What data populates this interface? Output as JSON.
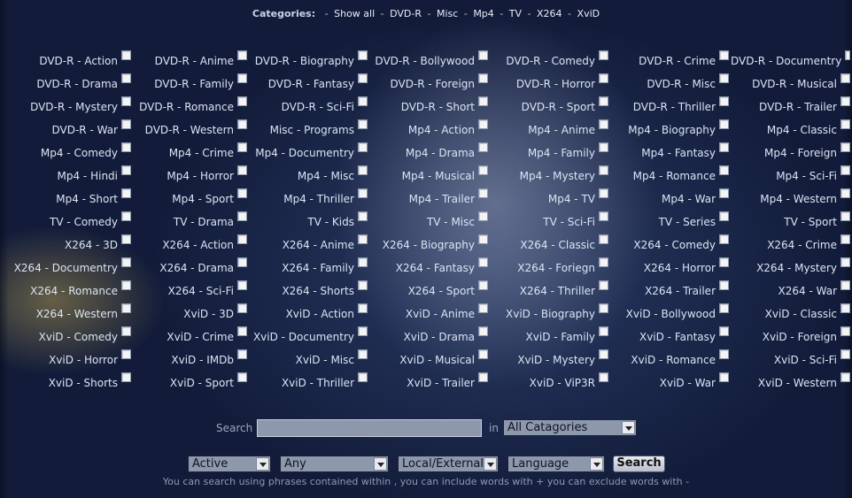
{
  "categories_bar": {
    "label": "Categories:",
    "links": [
      "Show all",
      "DVD-R",
      "Misc",
      "Mp4",
      "TV",
      "X264",
      "XviD"
    ]
  },
  "category_grid": [
    [
      "DVD-R - Action",
      "DVD-R - Anime",
      "DVD-R - Biography",
      "DVD-R - Bollywood",
      "DVD-R - Comedy",
      "DVD-R - Crime",
      "DVD-R - Documentry"
    ],
    [
      "DVD-R - Drama",
      "DVD-R - Family",
      "DVD-R - Fantasy",
      "DVD-R - Foreign",
      "DVD-R - Horror",
      "DVD-R - Misc",
      "DVD-R - Musical"
    ],
    [
      "DVD-R - Mystery",
      "DVD-R - Romance",
      "DVD-R - Sci-Fi",
      "DVD-R - Short",
      "DVD-R - Sport",
      "DVD-R - Thriller",
      "DVD-R - Trailer"
    ],
    [
      "DVD-R - War",
      "DVD-R - Western",
      "Misc - Programs",
      "Mp4 - Action",
      "Mp4 - Anime",
      "Mp4 - Biography",
      "Mp4 - Classic"
    ],
    [
      "Mp4 - Comedy",
      "Mp4 - Crime",
      "Mp4 - Documentry",
      "Mp4 - Drama",
      "Mp4 - Family",
      "Mp4 - Fantasy",
      "Mp4 - Foreign"
    ],
    [
      "Mp4 - Hindi",
      "Mp4 - Horror",
      "Mp4 - Misc",
      "Mp4 - Musical",
      "Mp4 - Mystery",
      "Mp4 - Romance",
      "Mp4 - Sci-Fi"
    ],
    [
      "Mp4 - Short",
      "Mp4 - Sport",
      "Mp4 - Thriller",
      "Mp4 - Trailer",
      "Mp4 - TV",
      "Mp4 - War",
      "Mp4 - Western"
    ],
    [
      "TV - Comedy",
      "TV - Drama",
      "TV - Kids",
      "TV - Misc",
      "TV - Sci-Fi",
      "TV - Series",
      "TV - Sport"
    ],
    [
      "X264 - 3D",
      "X264 - Action",
      "X264 - Anime",
      "X264 - Biography",
      "X264 - Classic",
      "X264 - Comedy",
      "X264 - Crime"
    ],
    [
      "X264 - Documentry",
      "X264 - Drama",
      "X264 - Family",
      "X264 - Fantasy",
      "X264 - Foriegn",
      "X264 - Horror",
      "X264 - Mystery"
    ],
    [
      "X264 - Romance",
      "X264 - Sci-Fi",
      "X264 - Shorts",
      "X264 - Sport",
      "X264 - Thriller",
      "X264 - Trailer",
      "X264 - War"
    ],
    [
      "X264 - Western",
      "XviD - 3D",
      "XviD - Action",
      "XviD - Anime",
      "XviD - Biography",
      "XviD - Bollywood",
      "XviD - Classic"
    ],
    [
      "XviD - Comedy",
      "XviD - Crime",
      "XviD - Documentry",
      "XviD - Drama",
      "XviD - Family",
      "XviD - Fantasy",
      "XviD - Foreign"
    ],
    [
      "XviD - Horror",
      "XviD - IMDb",
      "XviD - Misc",
      "XviD - Musical",
      "XviD - Mystery",
      "XviD - Romance",
      "XviD - Sci-Fi"
    ],
    [
      "XviD - Shorts",
      "XviD - Sport",
      "XviD - Thriller",
      "XviD - Trailer",
      "XviD - ViP3R",
      "XviD - War",
      "XviD - Western"
    ]
  ],
  "search": {
    "label": "Search",
    "value": "",
    "in_label": "in",
    "category_select": "All Catagories"
  },
  "filters": {
    "status": "Active",
    "type": "Any",
    "source": "Local/External",
    "language": "Language",
    "button": "Search"
  },
  "hint": "You can search using phrases contained within , you can include words with + you can exclude words with -",
  "colors": {
    "background": "#121c3a",
    "text": "#dbe4f3",
    "input": "#8e98ad"
  }
}
